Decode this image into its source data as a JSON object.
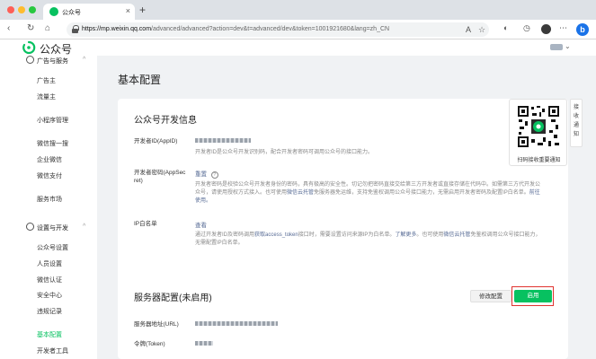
{
  "browser": {
    "tab_title": "公众号",
    "tab_close": "×",
    "new_tab": "+",
    "url_host": "https://mp.weixin.qq.com",
    "url_path": "/advanced/advanced?action=dev&t=advanced/dev&token=1001921680&lang=zh_CN",
    "icons": [
      "back-icon",
      "forward-icon",
      "reload-icon",
      "home-icon",
      "lock-icon",
      "read-aloud-icon",
      "favorite-icon",
      "collections-icon",
      "history-icon",
      "profile-icon",
      "bing-icon"
    ]
  },
  "header": {
    "logo_text": "公众号",
    "user_chevron": "⌄"
  },
  "sidebar": {
    "top_group_label": "广告与服务",
    "items_ads": [
      "广告主",
      "流量主"
    ],
    "item_miniprogram": "小程序管理",
    "items_wechat": [
      "微信搜一搜",
      "企业微信",
      "微信支付"
    ],
    "item_service_market": "服务市场",
    "dev_group_label": "设置与开发",
    "items_settings": [
      "公众号设置",
      "人员设置",
      "微信认证",
      "安全中心",
      "违规记录"
    ],
    "active_item": "基本配置",
    "item_dev_tools": "开发者工具",
    "chevron": "^"
  },
  "main": {
    "title": "基本配置",
    "dev_info": {
      "title": "公众号开发信息",
      "appid_label": "开发者ID(AppID)",
      "appid_desc": "开发者ID是公众号开发识别码，配合开发者密码可调用公众号的接口能力。",
      "secret_label_1": "开发者密码(AppSec",
      "secret_label_2": "ret)",
      "secret_action": "重置",
      "secret_help": "?",
      "secret_desc_1": "开发者密码是校验公众号开发者身份的密码，具有极高的安全性。切记勿把密码直接交给第三方开发者或直接存储在代码中。如需第三方代开发公",
      "secret_desc_2a": "众号，请使用授权方式接入。也可使用",
      "secret_desc_2_link": "微信云托管",
      "secret_desc_2b": "免服务器免运维，支持免鉴权调用公众号接口能力，无需启用开发者密码及配置IP白名单。",
      "secret_desc_2_link2": "前往",
      "secret_desc_3_link": "使用。",
      "ip_label": "IP白名单",
      "ip_action": "查看",
      "ip_desc_1a": "通过开发者ID及密码调用",
      "ip_desc_1_link": "获取access_token",
      "ip_desc_1b": "接口时，需要设置访问来源IP为白名单。",
      "ip_desc_1_link2": "了解更多",
      "ip_desc_1c": "。也可使用",
      "ip_desc_1_link3": "微信云托管",
      "ip_desc_1d": "免鉴权调用公众号接口能力，",
      "ip_desc_2": "无需配置IP白名单。"
    },
    "server": {
      "title": "服务器配置(未启用)",
      "modify_button": "修改配置",
      "enable_button": "启用",
      "url_label": "服务器地址(URL)",
      "token_label": "令牌(Token)"
    }
  },
  "qr_panel": {
    "caption": "扫码接收重要通知"
  },
  "side_tab": {
    "text": [
      "接",
      "收",
      "通",
      "知"
    ]
  },
  "colors": {
    "brand_green": "#07c160",
    "link_blue": "#576b95",
    "highlight_red": "#e0332f"
  }
}
